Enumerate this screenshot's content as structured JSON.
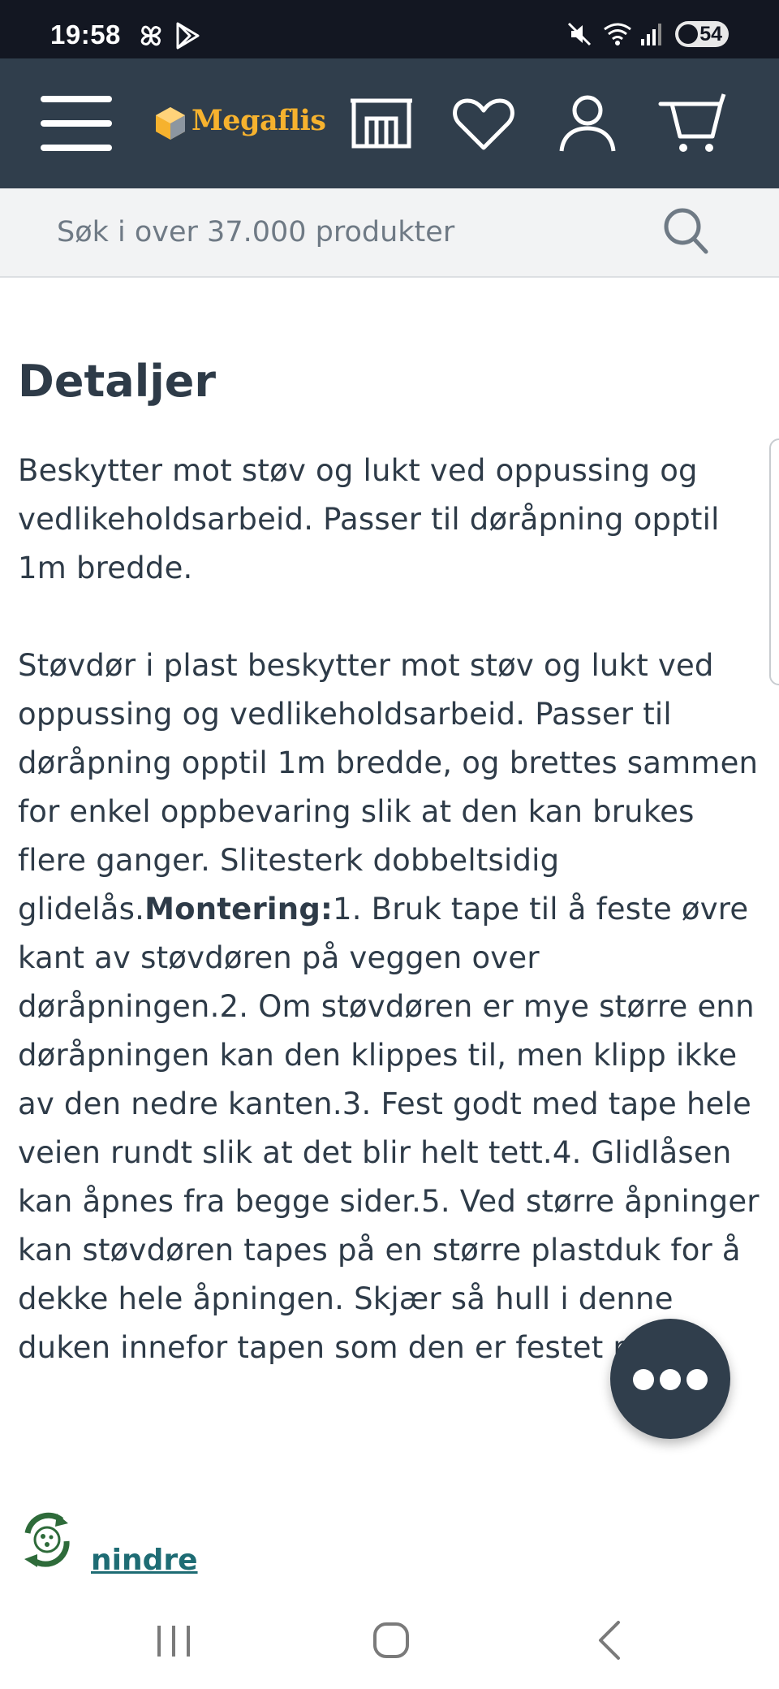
{
  "status_bar": {
    "time": "19:58",
    "battery": "54",
    "icons": [
      "pinwheel-icon",
      "play-store-icon",
      "mute-icon",
      "wifi-icon",
      "signal-icon",
      "battery-icon"
    ]
  },
  "header": {
    "logo_text": "Megaflis",
    "brand_color": "#f6b22e",
    "background": "#303e4c",
    "icons": [
      "menu-icon",
      "store-icon",
      "heart-icon",
      "account-icon",
      "cart-icon"
    ]
  },
  "search": {
    "placeholder": "Søk i over 37.000 produkter"
  },
  "details": {
    "title": "Detaljer",
    "summary": "Beskytter mot støv og lukt ved oppussing og vedlikeholdsarbeid. Passer til døråpning opptil 1m bredde.",
    "body_before": "Støvdør i plast beskytter mot støv og lukt ved oppussing og vedlikeholdsarbeid. Passer til døråpning opptil 1m bredde, og brettes sammen for enkel oppbevaring slik at den kan brukes flere ganger. Slitesterk dobbeltsidig glidelås.",
    "body_bold": "Montering:",
    "body_after": "1. Bruk tape til å feste øvre kant av støvdøren på veggen over døråpningen.2. Om støvdøren er mye større enn døråpningen kan den klippes til, men klipp ikke av den nedre kanten.3. Fest godt med tape hele veien rundt slik at det blir helt tett.4. Glidlåsen kan åpnes fra begge sider.5. Ved større åpninger kan støvdøren tapes på en større plastduk for å dekke hele åpningen. Skjær så hull i denne duken innefor tapen som den er festet med."
  },
  "footer_link": {
    "label": "nindre",
    "color": "#1e6c74"
  },
  "fab": {
    "icon": "more-dots-icon"
  },
  "nav_bar": {
    "icons": [
      "recent-apps-icon",
      "home-icon",
      "back-icon"
    ]
  }
}
